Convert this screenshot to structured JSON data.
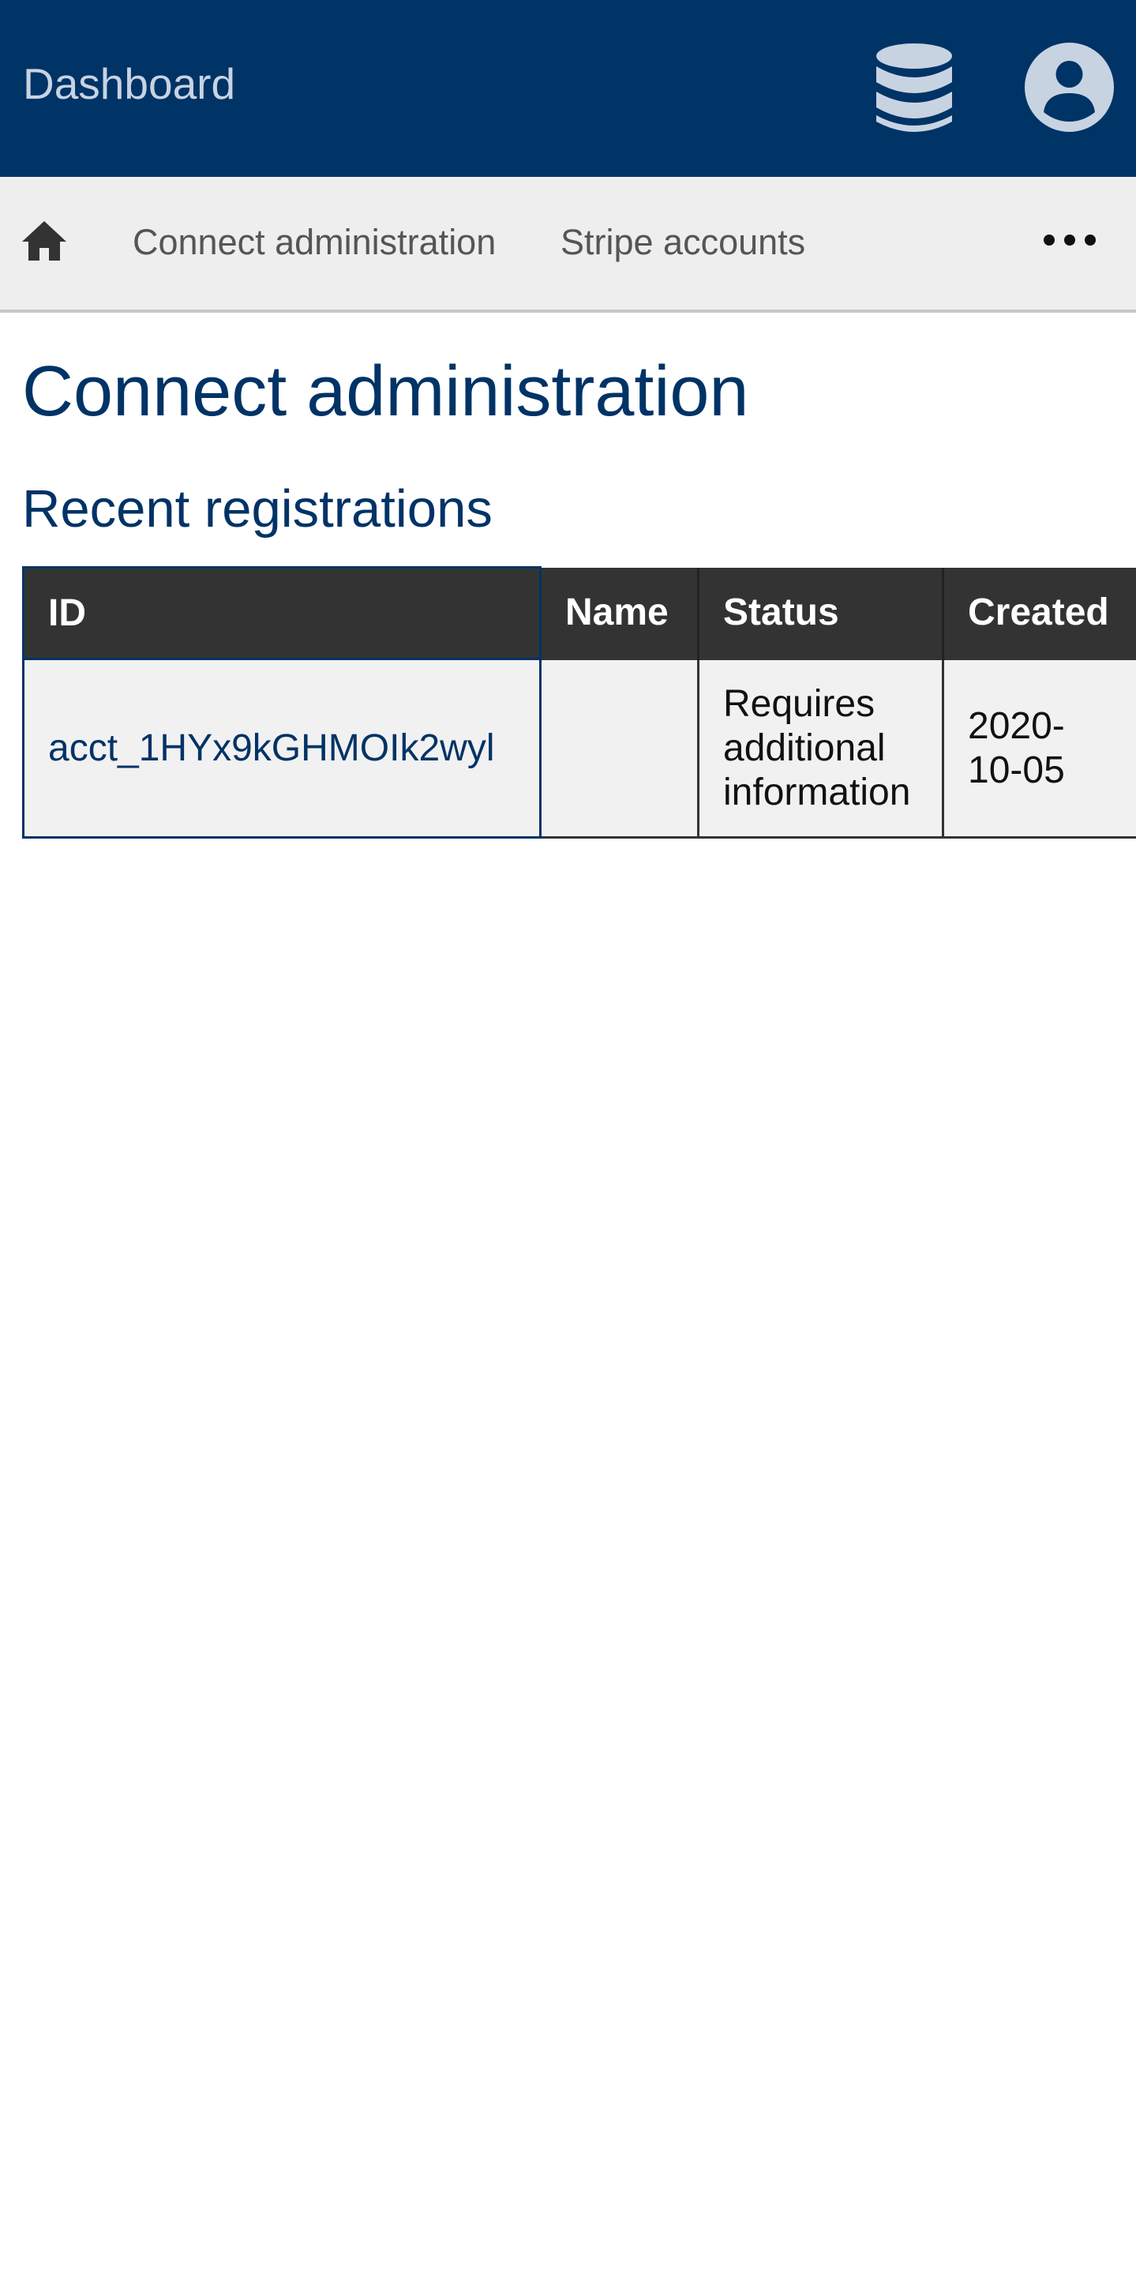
{
  "app_bar": {
    "title": "Dashboard",
    "background_color": "#003366",
    "database_icon": "database-icon",
    "account_icon": "account-circle-icon"
  },
  "nav": {
    "home_icon": "home-icon",
    "links": [
      "Connect administration",
      "Stripe accounts"
    ],
    "more_icon": "more-horizontal-icon"
  },
  "page": {
    "title": "Connect administration",
    "section_title": "Recent registrations"
  },
  "table": {
    "columns": [
      "ID",
      "Name",
      "Status",
      "Created"
    ],
    "rows": [
      {
        "id": "acct_1HYx9kGHMOIk2wyl",
        "name": "",
        "status": "Requires additional information",
        "created": "2020-10-05"
      }
    ]
  },
  "colors": {
    "brand": "#003366",
    "table_header": "#333333",
    "nav_background": "#eeeeee"
  }
}
